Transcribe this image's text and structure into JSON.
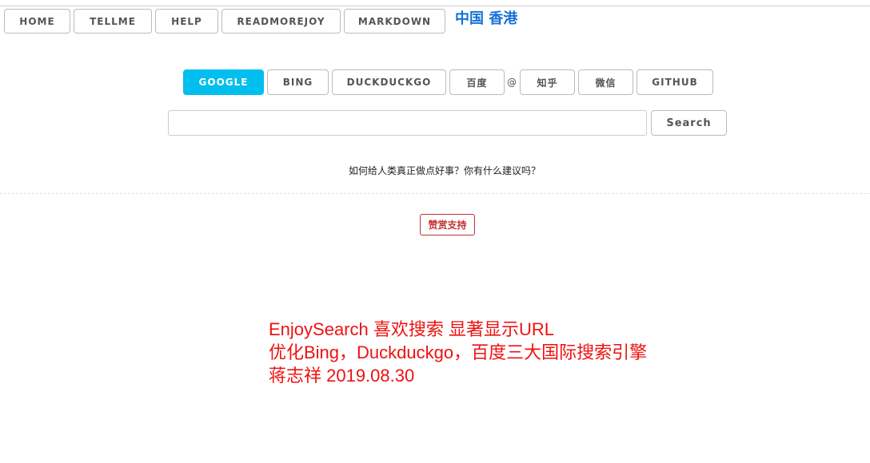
{
  "nav": {
    "items": [
      "HOME",
      "TELLME",
      "HELP",
      "READMOREJOY",
      "MARKDOWN"
    ],
    "region": "中国 香港"
  },
  "engines": {
    "items": [
      "GOOGLE",
      "BING",
      "DUCKDUCKGO",
      "百度",
      "知乎",
      "微信",
      "GITHUB"
    ],
    "separator": "@",
    "active": "GOOGLE",
    "active_color": "#00bfee"
  },
  "search": {
    "value": "",
    "placeholder": "",
    "button_label": "Search"
  },
  "question": "如何给人类真正做点好事？你有什么建议吗？",
  "donate_label": "赞赏支持",
  "notes": {
    "line1": "EnjoySearch 喜欢搜索 显著显示URL",
    "line2": "优化Bing，Duckduckgo，百度三大国际搜索引擎",
    "line3": "蒋志祥  2019.08.30"
  },
  "colors": {
    "region": "#1670d8",
    "notes": "#ee1111",
    "donate": "#c23333"
  }
}
